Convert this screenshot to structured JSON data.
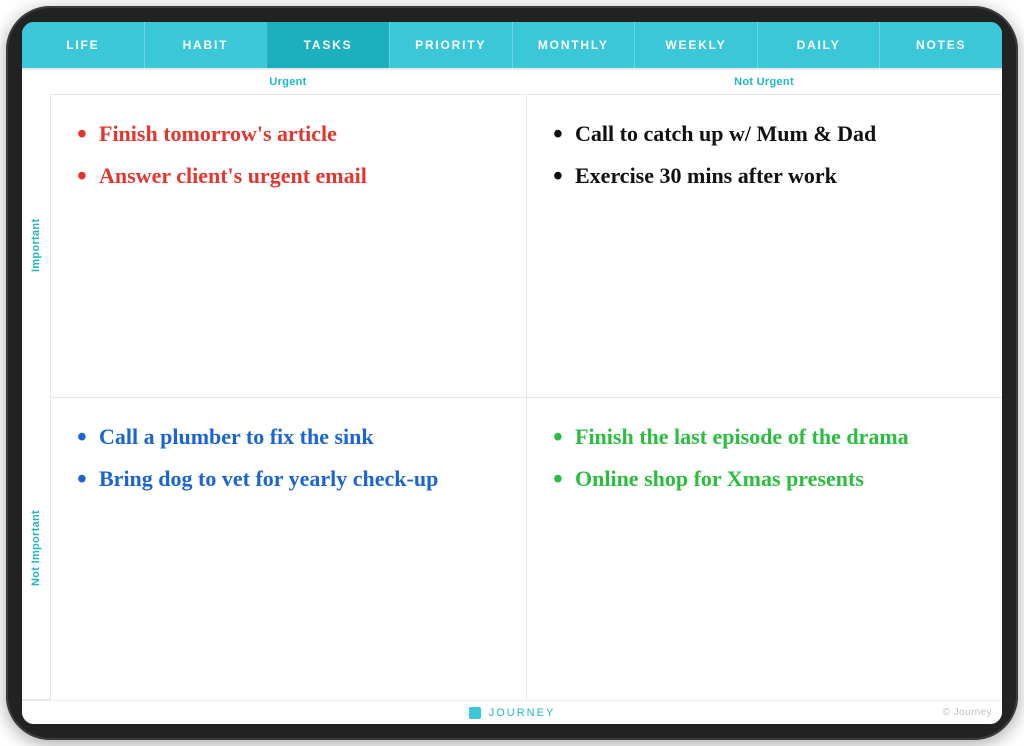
{
  "tabs": {
    "items": [
      {
        "label": "LIFE",
        "active": false
      },
      {
        "label": "HABIT",
        "active": false
      },
      {
        "label": "TASKS",
        "active": true
      },
      {
        "label": "PRIORITY",
        "active": false
      },
      {
        "label": "MONTHLY",
        "active": false
      },
      {
        "label": "WEEKLY",
        "active": false
      },
      {
        "label": "DAILY",
        "active": false
      },
      {
        "label": "NOTES",
        "active": false
      }
    ]
  },
  "columns": {
    "urgent": "Urgent",
    "not_urgent": "Not Urgent"
  },
  "rows": {
    "important": "Important",
    "not_important": "Not Important"
  },
  "quadrants": {
    "important_urgent": {
      "color": "#e2362f",
      "items": [
        "Finish tomorrow's article",
        "Answer client's urgent email"
      ]
    },
    "important_not_urgent": {
      "color": "#111111",
      "items": [
        "Call to catch up w/ Mum & Dad",
        "Exercise 30 mins after work"
      ]
    },
    "not_important_urgent": {
      "color": "#1a64d6",
      "items": [
        "Call a plumber to fix the sink",
        "Bring dog to vet for yearly check-up"
      ]
    },
    "not_important_not_urgent": {
      "color": "#2bbd3f",
      "items": [
        "Finish the last episode of the drama",
        "Online shop for Xmas presents"
      ]
    }
  },
  "footer": {
    "brand": "JOURNEY",
    "copyright": "© Journey"
  }
}
